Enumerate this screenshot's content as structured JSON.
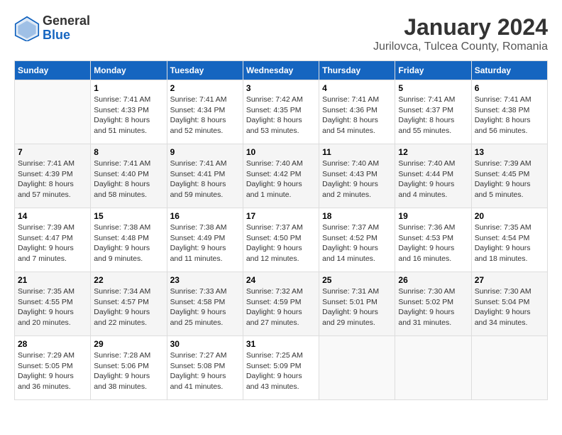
{
  "header": {
    "logo": {
      "general": "General",
      "blue": "Blue"
    },
    "title": "January 2024",
    "subtitle": "Jurilovca, Tulcea County, Romania"
  },
  "weekdays": [
    "Sunday",
    "Monday",
    "Tuesday",
    "Wednesday",
    "Thursday",
    "Friday",
    "Saturday"
  ],
  "weeks": [
    [
      {
        "day": "",
        "content": ""
      },
      {
        "day": "1",
        "content": "Sunrise: 7:41 AM\nSunset: 4:33 PM\nDaylight: 8 hours\nand 51 minutes."
      },
      {
        "day": "2",
        "content": "Sunrise: 7:41 AM\nSunset: 4:34 PM\nDaylight: 8 hours\nand 52 minutes."
      },
      {
        "day": "3",
        "content": "Sunrise: 7:42 AM\nSunset: 4:35 PM\nDaylight: 8 hours\nand 53 minutes."
      },
      {
        "day": "4",
        "content": "Sunrise: 7:41 AM\nSunset: 4:36 PM\nDaylight: 8 hours\nand 54 minutes."
      },
      {
        "day": "5",
        "content": "Sunrise: 7:41 AM\nSunset: 4:37 PM\nDaylight: 8 hours\nand 55 minutes."
      },
      {
        "day": "6",
        "content": "Sunrise: 7:41 AM\nSunset: 4:38 PM\nDaylight: 8 hours\nand 56 minutes."
      }
    ],
    [
      {
        "day": "7",
        "content": "Sunrise: 7:41 AM\nSunset: 4:39 PM\nDaylight: 8 hours\nand 57 minutes."
      },
      {
        "day": "8",
        "content": "Sunrise: 7:41 AM\nSunset: 4:40 PM\nDaylight: 8 hours\nand 58 minutes."
      },
      {
        "day": "9",
        "content": "Sunrise: 7:41 AM\nSunset: 4:41 PM\nDaylight: 8 hours\nand 59 minutes."
      },
      {
        "day": "10",
        "content": "Sunrise: 7:40 AM\nSunset: 4:42 PM\nDaylight: 9 hours\nand 1 minute."
      },
      {
        "day": "11",
        "content": "Sunrise: 7:40 AM\nSunset: 4:43 PM\nDaylight: 9 hours\nand 2 minutes."
      },
      {
        "day": "12",
        "content": "Sunrise: 7:40 AM\nSunset: 4:44 PM\nDaylight: 9 hours\nand 4 minutes."
      },
      {
        "day": "13",
        "content": "Sunrise: 7:39 AM\nSunset: 4:45 PM\nDaylight: 9 hours\nand 5 minutes."
      }
    ],
    [
      {
        "day": "14",
        "content": "Sunrise: 7:39 AM\nSunset: 4:47 PM\nDaylight: 9 hours\nand 7 minutes."
      },
      {
        "day": "15",
        "content": "Sunrise: 7:38 AM\nSunset: 4:48 PM\nDaylight: 9 hours\nand 9 minutes."
      },
      {
        "day": "16",
        "content": "Sunrise: 7:38 AM\nSunset: 4:49 PM\nDaylight: 9 hours\nand 11 minutes."
      },
      {
        "day": "17",
        "content": "Sunrise: 7:37 AM\nSunset: 4:50 PM\nDaylight: 9 hours\nand 12 minutes."
      },
      {
        "day": "18",
        "content": "Sunrise: 7:37 AM\nSunset: 4:52 PM\nDaylight: 9 hours\nand 14 minutes."
      },
      {
        "day": "19",
        "content": "Sunrise: 7:36 AM\nSunset: 4:53 PM\nDaylight: 9 hours\nand 16 minutes."
      },
      {
        "day": "20",
        "content": "Sunrise: 7:35 AM\nSunset: 4:54 PM\nDaylight: 9 hours\nand 18 minutes."
      }
    ],
    [
      {
        "day": "21",
        "content": "Sunrise: 7:35 AM\nSunset: 4:55 PM\nDaylight: 9 hours\nand 20 minutes."
      },
      {
        "day": "22",
        "content": "Sunrise: 7:34 AM\nSunset: 4:57 PM\nDaylight: 9 hours\nand 22 minutes."
      },
      {
        "day": "23",
        "content": "Sunrise: 7:33 AM\nSunset: 4:58 PM\nDaylight: 9 hours\nand 25 minutes."
      },
      {
        "day": "24",
        "content": "Sunrise: 7:32 AM\nSunset: 4:59 PM\nDaylight: 9 hours\nand 27 minutes."
      },
      {
        "day": "25",
        "content": "Sunrise: 7:31 AM\nSunset: 5:01 PM\nDaylight: 9 hours\nand 29 minutes."
      },
      {
        "day": "26",
        "content": "Sunrise: 7:30 AM\nSunset: 5:02 PM\nDaylight: 9 hours\nand 31 minutes."
      },
      {
        "day": "27",
        "content": "Sunrise: 7:30 AM\nSunset: 5:04 PM\nDaylight: 9 hours\nand 34 minutes."
      }
    ],
    [
      {
        "day": "28",
        "content": "Sunrise: 7:29 AM\nSunset: 5:05 PM\nDaylight: 9 hours\nand 36 minutes."
      },
      {
        "day": "29",
        "content": "Sunrise: 7:28 AM\nSunset: 5:06 PM\nDaylight: 9 hours\nand 38 minutes."
      },
      {
        "day": "30",
        "content": "Sunrise: 7:27 AM\nSunset: 5:08 PM\nDaylight: 9 hours\nand 41 minutes."
      },
      {
        "day": "31",
        "content": "Sunrise: 7:25 AM\nSunset: 5:09 PM\nDaylight: 9 hours\nand 43 minutes."
      },
      {
        "day": "",
        "content": ""
      },
      {
        "day": "",
        "content": ""
      },
      {
        "day": "",
        "content": ""
      }
    ]
  ]
}
